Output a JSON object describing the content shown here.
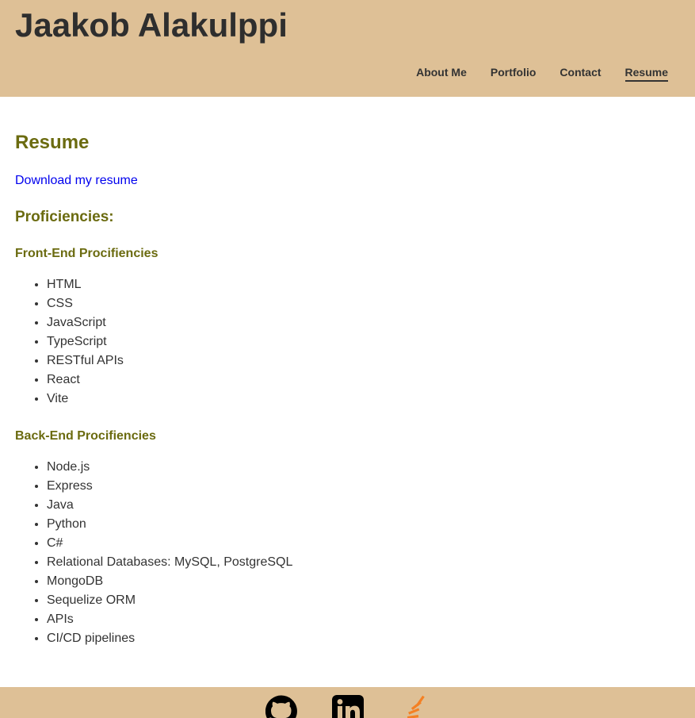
{
  "header": {
    "title": "Jaakob Alakulppi",
    "nav": [
      {
        "label": "About Me",
        "active": false
      },
      {
        "label": "Portfolio",
        "active": false
      },
      {
        "label": "Contact",
        "active": false
      },
      {
        "label": "Resume",
        "active": true
      }
    ]
  },
  "main": {
    "heading": "Resume",
    "download_link": "Download my resume",
    "proficiencies_heading": "Proficiencies:",
    "front_end": {
      "heading": "Front-End Procifiencies",
      "items": [
        "HTML",
        "CSS",
        "JavaScript",
        "TypeScript",
        "RESTful APIs",
        "React",
        "Vite"
      ]
    },
    "back_end": {
      "heading": "Back-End Procifiencies",
      "items": [
        "Node.js",
        "Express",
        "Java",
        "Python",
        "C#",
        "Relational Databases: MySQL, PostgreSQL",
        "MongoDB",
        "Sequelize ORM",
        "APIs",
        "CI/CD pipelines"
      ]
    }
  },
  "footer": {
    "icons": [
      "github-icon",
      "linkedin-icon",
      "stackoverflow-icon"
    ]
  },
  "colors": {
    "header_bg": "#dec096",
    "heading": "#6b6b10",
    "link": "#0000ee",
    "text": "#333333",
    "stackoverflow_orange": "#f48024"
  }
}
